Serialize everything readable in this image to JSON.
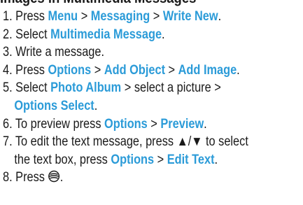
{
  "heading_partial": "Images in Multimedia Messages",
  "steps": [
    {
      "number": "1.",
      "parts": [
        {
          "t": "Press ",
          "hl": false
        },
        {
          "t": "Menu",
          "hl": true
        },
        {
          "t": " > ",
          "hl": false
        },
        {
          "t": "Messaging",
          "hl": true
        },
        {
          "t": " > ",
          "hl": false
        },
        {
          "t": "Write New",
          "hl": true
        },
        {
          "t": ".",
          "hl": false
        }
      ]
    },
    {
      "number": "2.",
      "parts": [
        {
          "t": "Select ",
          "hl": false
        },
        {
          "t": "Multimedia Message",
          "hl": true
        },
        {
          "t": ".",
          "hl": false
        }
      ]
    },
    {
      "number": "3.",
      "parts": [
        {
          "t": "Write a message.",
          "hl": false
        }
      ]
    },
    {
      "number": "4.",
      "parts": [
        {
          "t": "Press ",
          "hl": false
        },
        {
          "t": "Options",
          "hl": true
        },
        {
          "t": " > ",
          "hl": false
        },
        {
          "t": "Add Object",
          "hl": true
        },
        {
          "t": " > ",
          "hl": false
        },
        {
          "t": "Add Image",
          "hl": true
        },
        {
          "t": ".",
          "hl": false
        }
      ]
    },
    {
      "number": "5.",
      "parts": [
        {
          "t": "Select ",
          "hl": false
        },
        {
          "t": "Photo Album",
          "hl": true
        },
        {
          "t": " > select a picture >",
          "hl": false
        }
      ],
      "cont": [
        {
          "t": "Options Select",
          "hl": true
        },
        {
          "t": ".",
          "hl": false
        }
      ]
    },
    {
      "number": "6.",
      "parts": [
        {
          "t": "To preview press ",
          "hl": false
        },
        {
          "t": "Options",
          "hl": true
        },
        {
          "t": " > ",
          "hl": false
        },
        {
          "t": "Preview",
          "hl": true
        },
        {
          "t": ".",
          "hl": false
        }
      ]
    },
    {
      "number": "7.",
      "parts": [
        {
          "t": "To edit the text message, press ▲/▼ to select",
          "hl": false
        }
      ],
      "cont": [
        {
          "t": "the text box, press ",
          "hl": false
        },
        {
          "t": "Options",
          "hl": true
        },
        {
          "t": " > ",
          "hl": false
        },
        {
          "t": "Edit Text",
          "hl": true
        },
        {
          "t": ".",
          "hl": false
        }
      ]
    },
    {
      "number": "8.",
      "parts": [
        {
          "t": "Press ",
          "hl": false
        },
        {
          "t": "[send-key-icon]",
          "hl": false,
          "icon": "send-key-icon"
        },
        {
          "t": ".",
          "hl": false
        }
      ]
    }
  ],
  "colors": {
    "text": "#1a1a1a",
    "highlight": "#2b9bd8"
  }
}
